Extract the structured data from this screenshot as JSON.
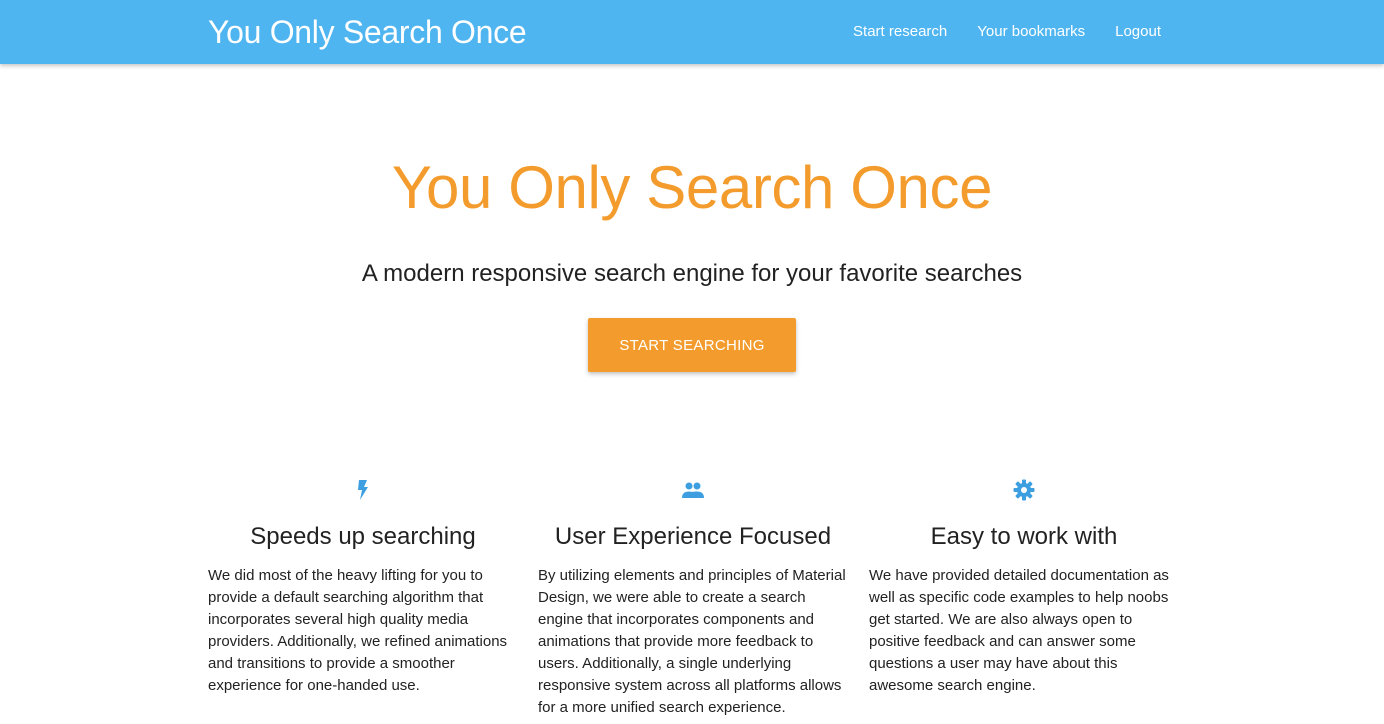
{
  "navbar": {
    "brand": "You Only Search Once",
    "links": [
      {
        "label": "Start research"
      },
      {
        "label": "Your bookmarks"
      },
      {
        "label": "Logout"
      }
    ]
  },
  "hero": {
    "title": "You Only Search Once",
    "subtitle": "A modern responsive search engine for your favorite searches",
    "button_label": "START SEARCHING"
  },
  "features": [
    {
      "icon": "flash-icon",
      "title": "Speeds up searching",
      "text": "We did most of the heavy lifting for you to provide a default searching algorithm that incorporates several high quality media providers. Additionally, we refined animations and transitions to provide a smoother experience for one-handed use."
    },
    {
      "icon": "group-icon",
      "title": "User Experience Focused",
      "text": "By utilizing elements and principles of Material Design, we were able to create a search engine that incorporates components and animations that provide more feedback to users. Additionally, a single underlying responsive system across all platforms allows for a more unified search experience."
    },
    {
      "icon": "gear-icon",
      "title": "Easy to work with",
      "text": "We have provided detailed documentation as well as specific code examples to help noobs get started. We are also always open to positive feedback and can answer some questions a user may have about this awesome search engine."
    }
  ],
  "colors": {
    "navbar": "#4fb5f0",
    "accent": "#f39c2d",
    "icon": "#3d9fe0"
  }
}
